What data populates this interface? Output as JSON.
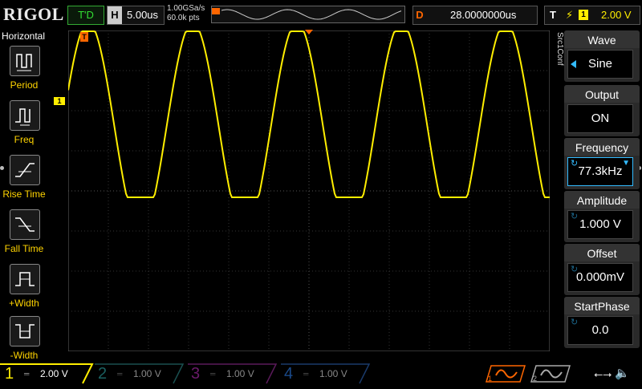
{
  "header": {
    "brand": "RIGOL",
    "trigger_status": "T'D",
    "horizontal": {
      "label": "H",
      "value": "5.00us"
    },
    "sample_rate": "1.00GSa/s",
    "memory_depth": "60.0k pts",
    "delay": {
      "label": "D",
      "value": "28.0000000us"
    },
    "trigger": {
      "label": "T",
      "edge": "rising-edge-icon",
      "channel": "1",
      "level": "2.00 V"
    }
  },
  "left_menu": {
    "title": "Horizontal",
    "items": [
      {
        "label": "Period",
        "icon": "period-icon"
      },
      {
        "label": "Freq",
        "icon": "frequency-icon"
      },
      {
        "label": "Rise Time",
        "icon": "rise-time-icon"
      },
      {
        "label": "Fall Time",
        "icon": "fall-time-icon"
      },
      {
        "label": "+Width",
        "icon": "positive-width-icon"
      },
      {
        "label": "-Width",
        "icon": "negative-width-icon"
      }
    ]
  },
  "waveform": {
    "channel_marker": "1",
    "source_label": "Src1Conf",
    "color": "#ffee00"
  },
  "right_menu": {
    "items": [
      {
        "title": "Wave",
        "value": "Sine"
      },
      {
        "title": "Output",
        "value": "ON"
      },
      {
        "title": "Frequency",
        "value": "77.3kHz"
      },
      {
        "title": "Amplitude",
        "value": "1.000 V"
      },
      {
        "title": "Offset",
        "value": "0.000mV"
      },
      {
        "title": "StartPhase",
        "value": "0.0"
      }
    ]
  },
  "channels": [
    {
      "num": "1",
      "value": "2.00 V",
      "color": "#ffee00"
    },
    {
      "num": "2",
      "value": "1.00 V",
      "color": "#00c0c0"
    },
    {
      "num": "3",
      "value": "1.00 V",
      "color": "#d020d0"
    },
    {
      "num": "4",
      "value": "1.00 V",
      "color": "#2080ff"
    }
  ],
  "generators": [
    {
      "num": "1",
      "color": "#ff6600"
    },
    {
      "num": "2",
      "color": "#aaaaaa"
    }
  ],
  "status_icons": [
    "usb-icon",
    "speaker-icon"
  ]
}
